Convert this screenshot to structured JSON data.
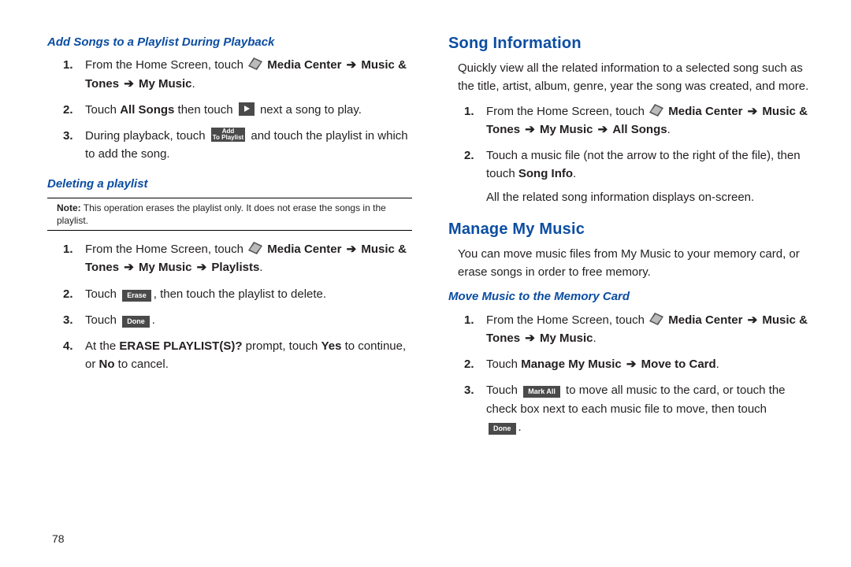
{
  "left": {
    "h_add": "Add Songs to a Playlist During Playback",
    "add": {
      "s1a": "From the Home Screen, touch ",
      "path1a": "Media Center",
      "path1b": "Music & Tones",
      "path1c": "My Music",
      "s2a": "Touch ",
      "s2b": "All Songs",
      "s2c": " then touch ",
      "s2d": " next a song to play.",
      "s3a": "During playback, touch ",
      "s3b": " and touch the playlist in which to add the song.",
      "chip_add_l1": "Add",
      "chip_add_l2": "To Playlist"
    },
    "h_del": "Deleting a playlist",
    "note_label": "Note:",
    "note_text": " This operation erases the playlist only. It does not erase the songs in the playlist.",
    "del": {
      "s1a": "From the Home Screen, touch ",
      "path1a": "Media Center",
      "path1b": "Music & Tones",
      "path1c": "My Music",
      "path1d": "Playlists",
      "s2a": "Touch ",
      "s2b": ", then touch the playlist to delete.",
      "chip_erase": "Erase",
      "s3a": "Touch ",
      "chip_done": "Done",
      "s3b": ".",
      "s4a": "At the ",
      "s4b": "ERASE PLAYLIST(S)?",
      "s4c": " prompt, touch ",
      "s4d": "Yes",
      "s4e": " to continue, or ",
      "s4f": "No",
      "s4g": " to cancel."
    }
  },
  "right": {
    "h_info": "Song Information",
    "info_p": "Quickly view all the related information to a selected song such as the title, artist, album, genre, year the song was created, and more.",
    "info": {
      "s1a": "From the Home Screen, touch ",
      "path1a": "Media Center",
      "path1b": "Music & Tones",
      "path1c": "My Music",
      "path1d": "All Songs",
      "s2a": "Touch a music file (not the arrow to the right of the file), then touch ",
      "s2b": "Song Info",
      "s2c": ".",
      "s2d": "All the related song information displays on-screen."
    },
    "h_manage": "Manage My Music",
    "manage_p": "You can move music files from My Music to your memory card, or erase songs in order to free memory.",
    "h_move": "Move Music to the Memory Card",
    "move": {
      "s1a": "From the Home Screen, touch ",
      "path1a": "Media Center",
      "path1b": "Music & Tones",
      "path1c": "My Music",
      "s2a": "Touch ",
      "s2b": "Manage My Music",
      "s2c": "Move to Card",
      "s2d": ".",
      "s3a": "Touch ",
      "chip_markall": "Mark All",
      "s3b": " to move all music to the card, or touch the check box next to each music file to move, then touch ",
      "chip_done": "Done",
      "s3c": "."
    }
  },
  "page_number": "78"
}
